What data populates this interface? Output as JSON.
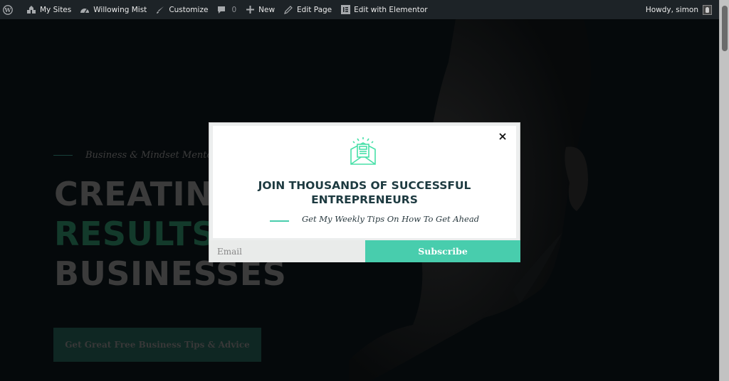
{
  "adminbar": {
    "wp_logo_icon": "wordpress-icon",
    "items": [
      {
        "icon": "my-sites-icon",
        "label": "My Sites"
      },
      {
        "icon": "dashboard-icon",
        "label": "Willowing Mist"
      },
      {
        "icon": "brush-icon",
        "label": "Customize"
      },
      {
        "icon": "comment-icon",
        "label": "",
        "count": "0"
      },
      {
        "icon": "plus-icon",
        "label": "New"
      },
      {
        "icon": "pencil-icon",
        "label": "Edit Page"
      },
      {
        "icon": "elementor-icon",
        "label": "Edit with Elementor"
      }
    ],
    "greeting": "Howdy, simon"
  },
  "hero": {
    "tagline": "Business & Mindset Mentor",
    "headline_line1": "CREATING",
    "headline_line2": "RESULTS FOR",
    "headline_line3": "BUSINESSES",
    "cta_label": "Get Great Free Business Tips & Advice"
  },
  "popup": {
    "icon": "newsletter-envelope-icon",
    "title_line1": "JOIN THOUSANDS OF SUCCESSFUL",
    "title_line2": "ENTREPRENEURS",
    "subtitle": "Get My Weekly Tips On How To Get Ahead",
    "email_placeholder": "Email",
    "email_value": "",
    "subscribe_label": "Subscribe",
    "close_icon": "close-icon"
  },
  "colors": {
    "accent": "#48cdad",
    "heading": "#1d3a40",
    "adminbar_bg": "#1d2327"
  }
}
